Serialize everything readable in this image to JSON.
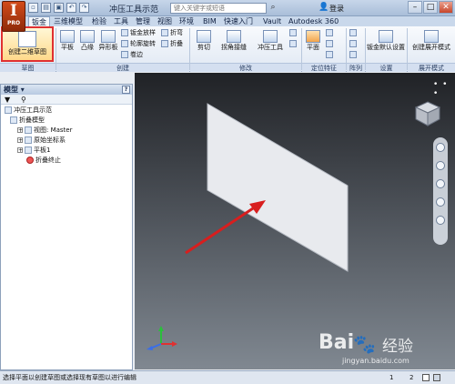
{
  "titlebar": {
    "app_letter": "I",
    "app_edition": "PRO",
    "doc_title": "冲压工具示范",
    "search_placeholder": "键入关键字或短语",
    "login_label": "登录"
  },
  "tabs": [
    "钣金",
    "三维模型",
    "检验",
    "工具",
    "管理",
    "视图",
    "环境",
    "BIM",
    "快速入门",
    "Vault",
    "Autodesk 360"
  ],
  "active_tab": "钣金",
  "ribbon": {
    "create_sketch": "创建二维草图",
    "flat": "平板",
    "contour": "凸缘",
    "contour_flange": "异形板",
    "sheet_lofted": "钣金放样",
    "contour_roll": "轮廓旋转",
    "rolled": "卷边",
    "fold": "折弯",
    "fold2": "折叠",
    "cut": "剪切",
    "corner_round": "拐角接缝",
    "punch_tool": "冲压工具",
    "plane": "平面",
    "sheet_defaults": "钣金默认设置",
    "create_flat_pattern": "创建展开模式",
    "panels": {
      "sketch": "草图",
      "create": "创建",
      "modify": "修改",
      "work_features": "定位特征",
      "pattern": "阵列",
      "setup": "设置",
      "flat_pattern": "展开模式"
    }
  },
  "model_panel": {
    "title": "模型",
    "tree": [
      {
        "label": "冲压工具示范",
        "level": 0
      },
      {
        "label": "折叠模型",
        "level": 1
      },
      {
        "label": "视图: Master",
        "level": 1
      },
      {
        "label": "原始坐标系",
        "level": 1
      },
      {
        "label": "平板1",
        "level": 1
      },
      {
        "label": "折叠终止",
        "level": 1
      }
    ]
  },
  "status": {
    "message": "选择平面以创建草图或选择现有草图以进行编辑",
    "count1": "1",
    "count2": "2"
  },
  "watermark": {
    "brand": "Bai",
    "brand2": "经验",
    "url": "jingyan.baidu.com"
  },
  "colors": {
    "highlight": "#e03131",
    "arrow": "#d81e1e"
  }
}
